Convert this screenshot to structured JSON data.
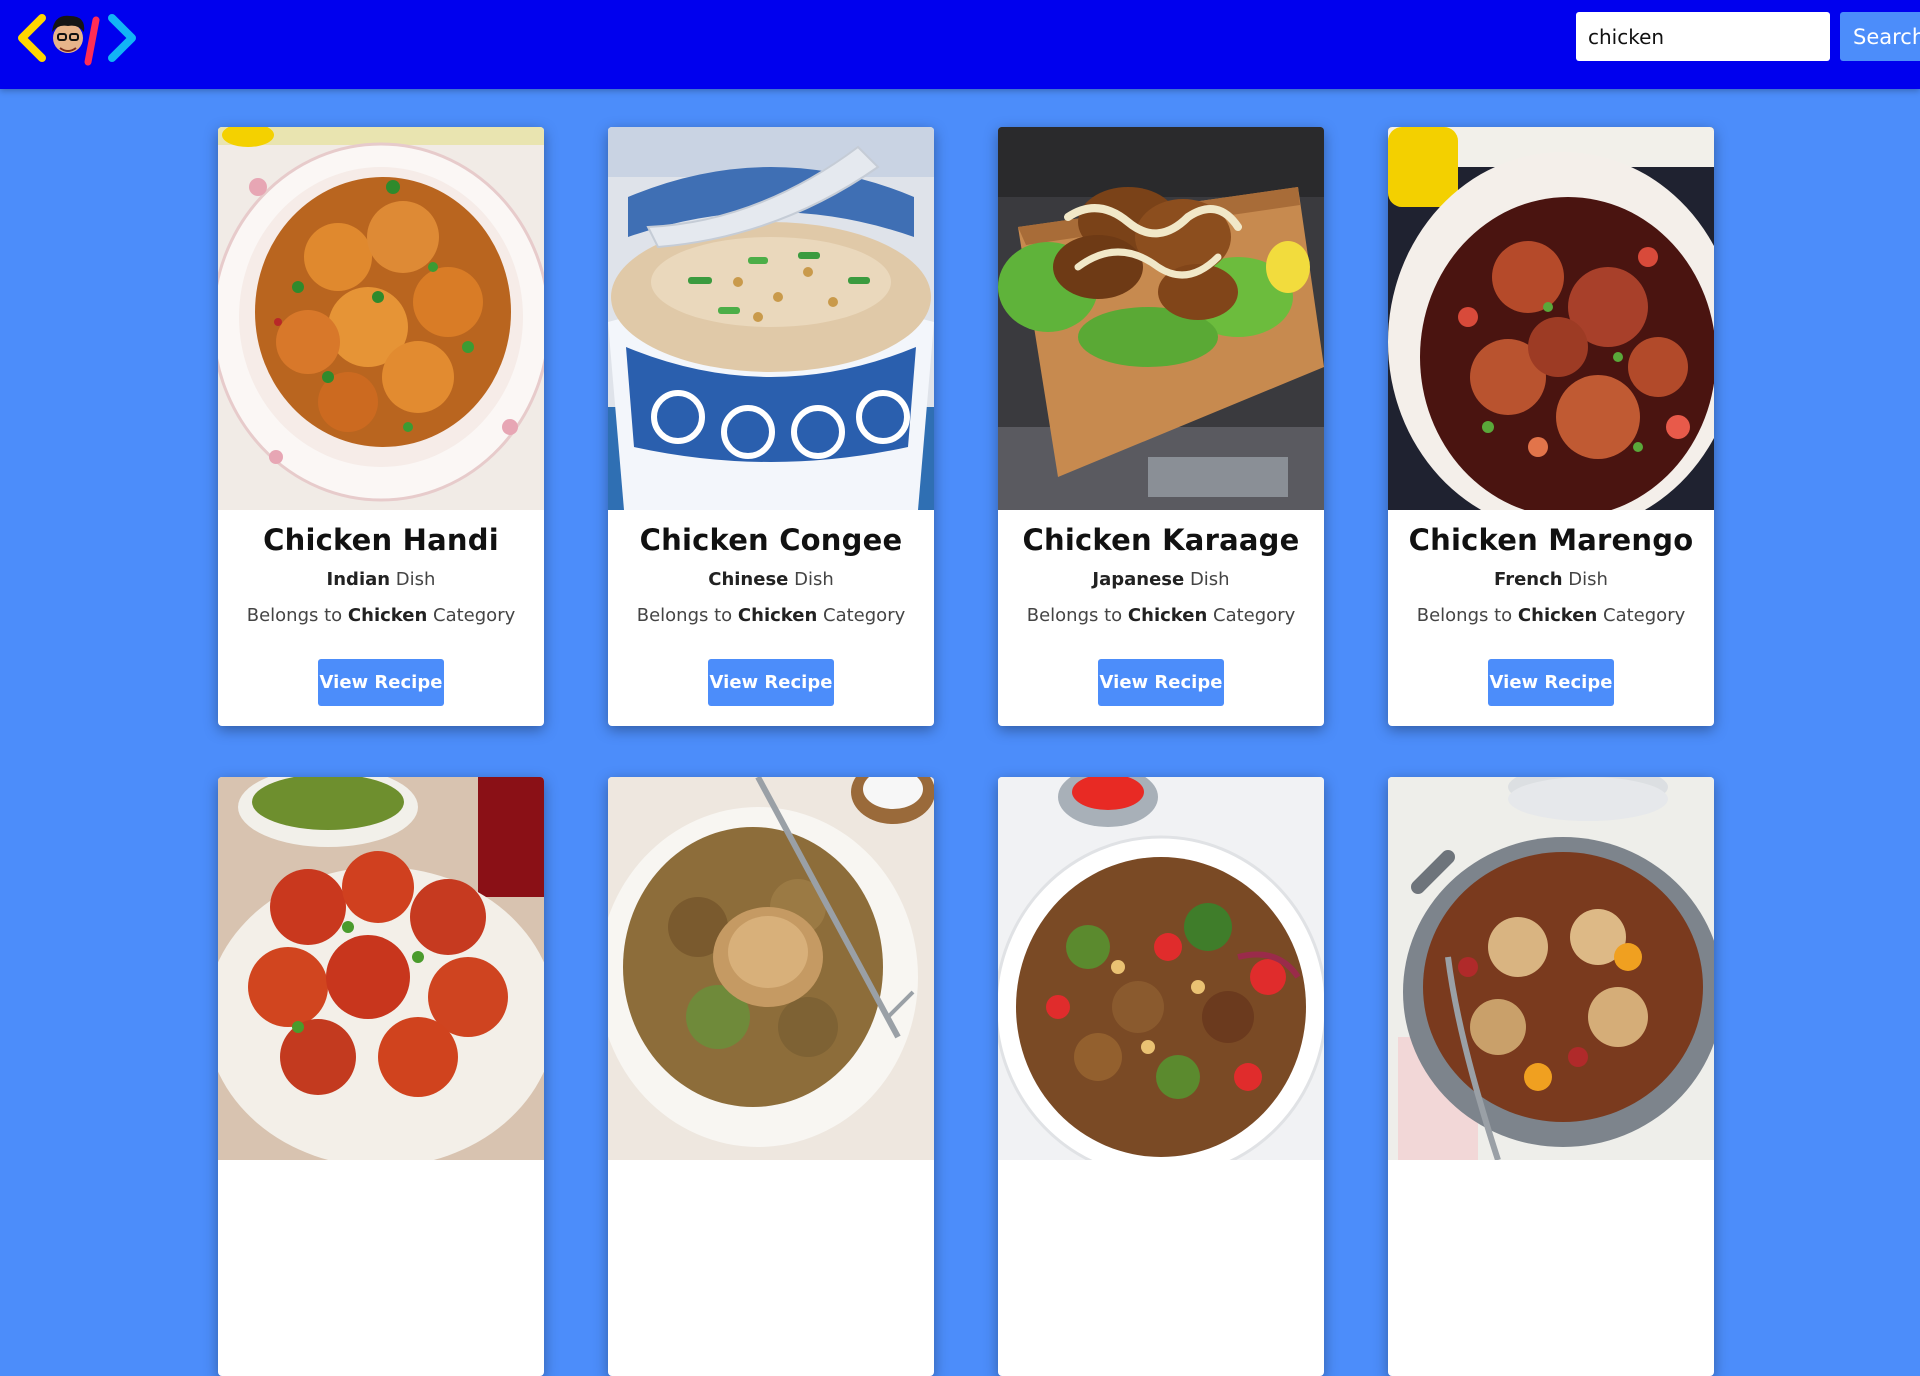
{
  "header": {
    "search": {
      "value": "chicken",
      "placeholder": ""
    },
    "search_button_label": "Search",
    "colors": {
      "navbar": "#0000ee",
      "page_background": "#4c8dfa",
      "button": "#4c8dfa"
    }
  },
  "meals": [
    {
      "title": "Chicken Handi",
      "area": "Indian",
      "area_suffix": " Dish",
      "category_prefix": "Belongs to ",
      "category": "Chicken",
      "category_suffix": " Category",
      "button_label": "View Recipe",
      "image": "chicken-handi-curry"
    },
    {
      "title": "Chicken Congee",
      "area": "Chinese",
      "area_suffix": " Dish",
      "category_prefix": "Belongs to ",
      "category": "Chicken",
      "category_suffix": " Category",
      "button_label": "View Recipe",
      "image": "chicken-congee-bowl"
    },
    {
      "title": "Chicken Karaage",
      "area": "Japanese",
      "area_suffix": " Dish",
      "category_prefix": "Belongs to ",
      "category": "Chicken",
      "category_suffix": " Category",
      "button_label": "View Recipe",
      "image": "chicken-karaage-board"
    },
    {
      "title": "Chicken Marengo",
      "area": "French",
      "area_suffix": " Dish",
      "category_prefix": "Belongs to ",
      "category": "Chicken",
      "category_suffix": " Category",
      "button_label": "View Recipe",
      "image": "chicken-marengo-pot"
    },
    {
      "image": "tandoori-chicken-platter"
    },
    {
      "image": "chicken-grain-bowl"
    },
    {
      "image": "chicken-stir-fry-bowl"
    },
    {
      "image": "chicken-casserole-pan"
    }
  ]
}
